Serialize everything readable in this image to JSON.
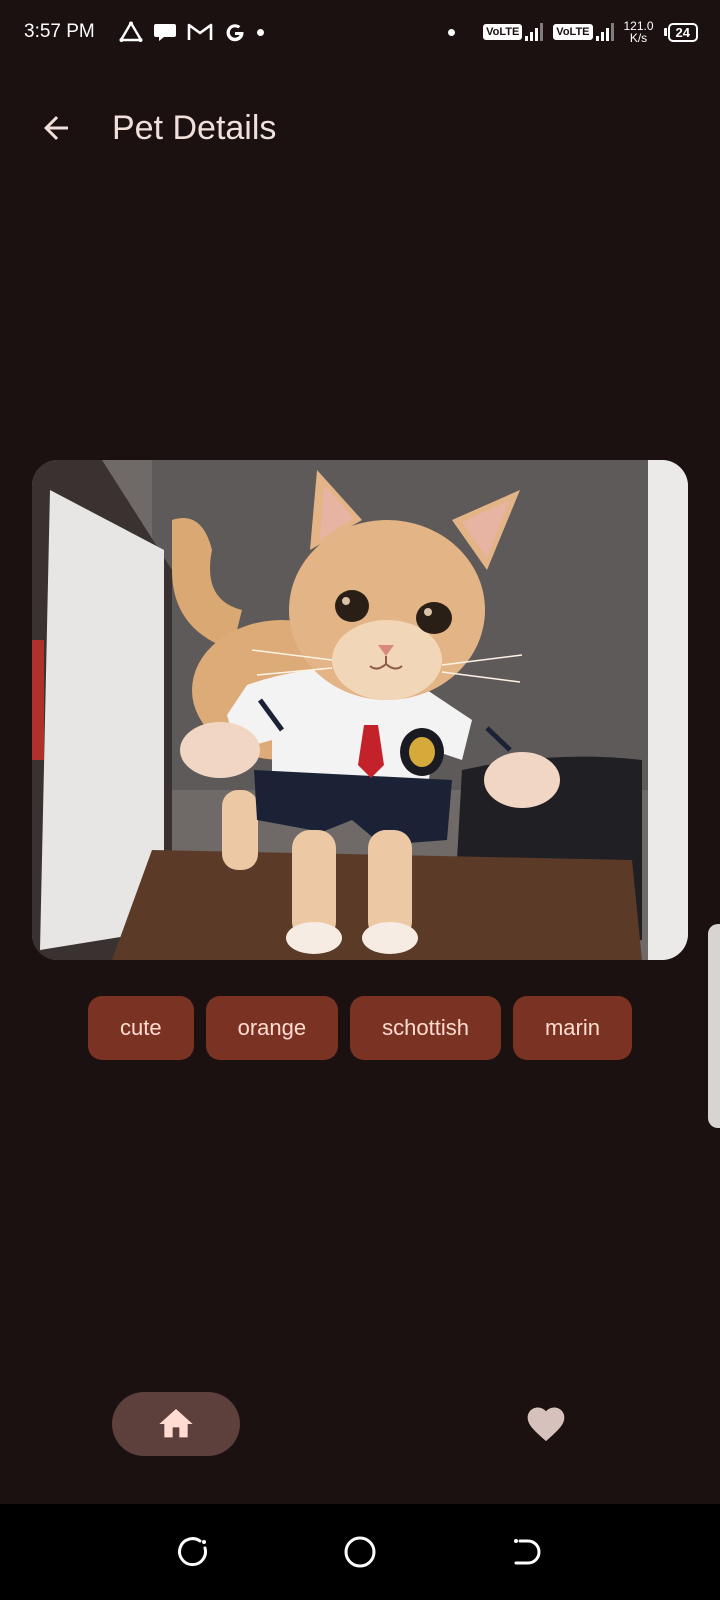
{
  "status_bar": {
    "time": "3:57 PM",
    "notification_icons": [
      "drive-icon",
      "chat-icon",
      "gmail-icon",
      "google-icon",
      "dot-icon"
    ],
    "volte_1": "VoLTE",
    "volte_2": "VoLTE",
    "net_speed_value": "121.0",
    "net_speed_unit": "K/s",
    "battery": "24"
  },
  "app_bar": {
    "title": "Pet Details",
    "back_icon": "arrow-back-icon"
  },
  "pet": {
    "image_description_icon": "cat-photo"
  },
  "tags": [
    {
      "label": "cute"
    },
    {
      "label": "orange"
    },
    {
      "label": "schottish"
    },
    {
      "label": "marin"
    }
  ],
  "bottom_nav": {
    "home_icon": "home-icon",
    "favorites_icon": "heart-icon",
    "active": "home"
  },
  "colors": {
    "background": "#1a1110",
    "tag_bg": "#7a3323",
    "tag_text": "#ffdbd1",
    "nav_active_bg": "#5d3f3b",
    "on_surface": "#f1dfdb"
  }
}
